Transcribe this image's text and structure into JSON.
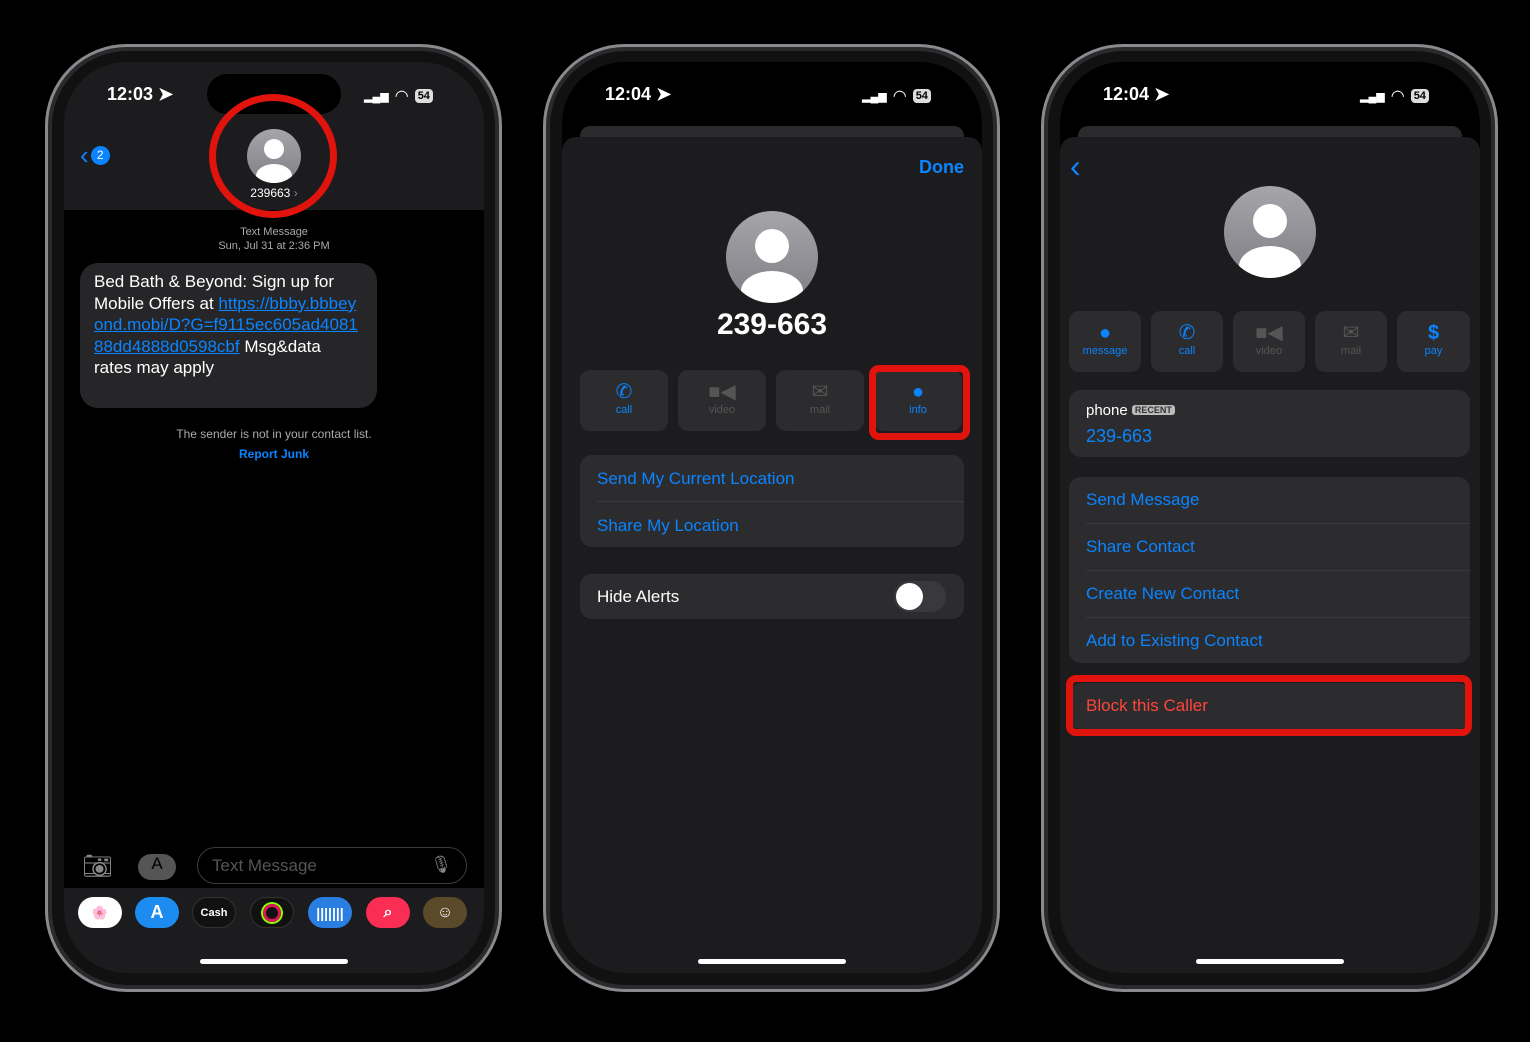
{
  "phone1": {
    "time": "12:03",
    "battery": "54",
    "back_badge": "2",
    "contact": "239663",
    "meta_type": "Text Message",
    "meta_date": "Sun, Jul 31 at 2:36 PM",
    "message_text_1": "Bed Bath & Beyond: Sign up for Mobile Offers at ",
    "message_link": "https://bbby.bbbeyond.mobi/D?G=f9115ec605ad408188dd4888d0598cbf",
    "message_text_2": " Msg&data rates may apply",
    "sender_note": "The sender is not in your contact list.",
    "report_junk": "Report Junk",
    "input_placeholder": "Text Message",
    "apps": [
      "photos",
      "app-store",
      "Cash",
      "fitness",
      "soundhound",
      "search-images",
      "memoji"
    ]
  },
  "phone2": {
    "time": "12:04",
    "battery": "54",
    "done": "Done",
    "number": "239-663",
    "actions": [
      {
        "label": "call",
        "enabled": true
      },
      {
        "label": "video",
        "enabled": false
      },
      {
        "label": "mail",
        "enabled": false
      },
      {
        "label": "info",
        "enabled": true
      }
    ],
    "location_rows": [
      "Send My Current Location",
      "Share My Location"
    ],
    "hide_alerts": "Hide Alerts",
    "hide_alerts_on": false
  },
  "phone3": {
    "time": "12:04",
    "battery": "54",
    "actions": [
      {
        "label": "message",
        "enabled": true
      },
      {
        "label": "call",
        "enabled": true
      },
      {
        "label": "video",
        "enabled": false
      },
      {
        "label": "mail",
        "enabled": false
      },
      {
        "label": "pay",
        "enabled": true
      }
    ],
    "phone_label": "phone",
    "recent_badge": "RECENT",
    "phone_number": "239-663",
    "rows": [
      "Send Message",
      "Share Contact",
      "Create New Contact",
      "Add to Existing Contact"
    ],
    "block": "Block this Caller"
  },
  "colors": {
    "accent": "#0a84ff",
    "highlight": "#e0140c",
    "destructive": "#ff453a"
  }
}
